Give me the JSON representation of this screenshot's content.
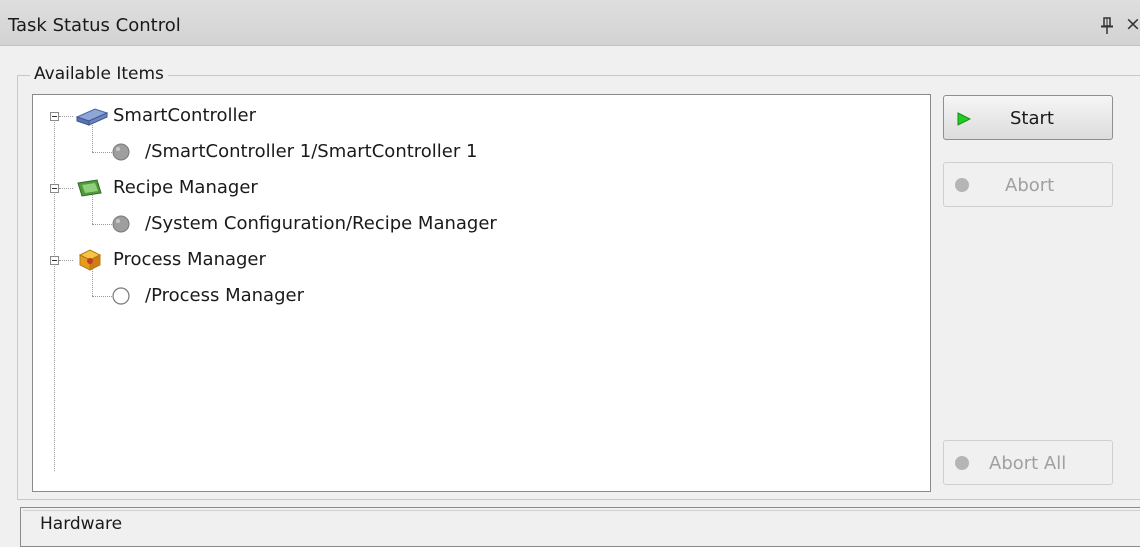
{
  "panel": {
    "title": "Task Status Control",
    "pin_icon": "pin-icon",
    "close_label": "×"
  },
  "available_items": {
    "legend": "Available Items",
    "tree": [
      {
        "label": "SmartController",
        "icon": "controller-icon",
        "expanded": true,
        "children": [
          {
            "label": "/SmartController 1/SmartController 1",
            "icon": "status-gray-icon"
          }
        ]
      },
      {
        "label": "Recipe Manager",
        "icon": "recipe-icon",
        "expanded": true,
        "children": [
          {
            "label": "/System Configuration/Recipe Manager",
            "icon": "status-gray-icon"
          }
        ]
      },
      {
        "label": "Process Manager",
        "icon": "process-manager-icon",
        "expanded": true,
        "children": [
          {
            "label": "/Process Manager",
            "icon": "status-empty-icon"
          }
        ]
      }
    ]
  },
  "buttons": {
    "start": {
      "label": "Start",
      "enabled": true,
      "icon": "play-icon",
      "icon_color": "#22cc22"
    },
    "abort": {
      "label": "Abort",
      "enabled": false,
      "icon": "stop-icon"
    },
    "abort_all": {
      "label": "Abort All",
      "enabled": false,
      "icon": "stop-icon"
    }
  },
  "hardware": {
    "legend": "Hardware"
  }
}
